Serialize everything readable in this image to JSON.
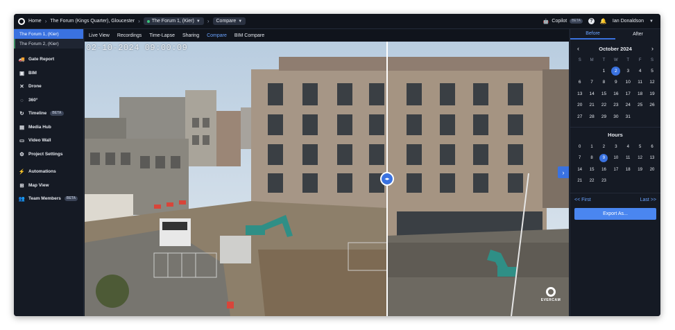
{
  "breadcrumb": {
    "home": "Home",
    "project": "The Forum (Kings Quarter), Gloucester",
    "camera": "The Forum 1, (Kier)",
    "page": "Compare"
  },
  "header": {
    "copilot": "Copilot",
    "copilot_badge": "BETA",
    "help_icon": "?",
    "user": "Ian Donaldson"
  },
  "sidebar": {
    "cameras": [
      "The Forum 1, (Kier)",
      "The Forum 2, (Kier)"
    ],
    "items": [
      {
        "label": "Gate Report",
        "icon": "truck-icon"
      },
      {
        "label": "BIM",
        "icon": "bim-icon"
      },
      {
        "label": "Drone",
        "icon": "drone-icon"
      },
      {
        "label": "360°",
        "icon": "360-icon"
      },
      {
        "label": "Timeline",
        "icon": "timeline-icon",
        "badge": "BETA"
      },
      {
        "label": "Media Hub",
        "icon": "media-icon"
      },
      {
        "label": "Video Wall",
        "icon": "video-wall-icon"
      },
      {
        "label": "Project Settings",
        "icon": "gear-icon"
      },
      {
        "label": "Automations",
        "icon": "automations-icon"
      },
      {
        "label": "Map View",
        "icon": "map-icon"
      },
      {
        "label": "Team Members",
        "icon": "team-icon",
        "badge": "BETA"
      }
    ]
  },
  "tabs": [
    "Live View",
    "Recordings",
    "Time-Lapse",
    "Sharing",
    "Compare",
    "BIM Compare"
  ],
  "active_tab": "Compare",
  "viewer": {
    "timestamp": "02-10-2024 09:00:09",
    "watermark": "EVERCAM"
  },
  "panel": {
    "before_label": "Before",
    "after_label": "After",
    "month": "October 2024",
    "weekdays": [
      "S",
      "M",
      "T",
      "W",
      "T",
      "F",
      "S"
    ],
    "days": [
      {
        "d": "",
        "m": false
      },
      {
        "d": "",
        "m": false
      },
      {
        "d": "1",
        "m": false
      },
      {
        "d": "2",
        "m": false,
        "sel": true
      },
      {
        "d": "3",
        "m": false
      },
      {
        "d": "4",
        "m": false
      },
      {
        "d": "5",
        "m": false
      },
      {
        "d": "6",
        "m": false
      },
      {
        "d": "7",
        "m": false
      },
      {
        "d": "8",
        "m": false
      },
      {
        "d": "9",
        "m": false
      },
      {
        "d": "10",
        "m": false
      },
      {
        "d": "11",
        "m": false
      },
      {
        "d": "12",
        "m": false
      },
      {
        "d": "13",
        "m": false
      },
      {
        "d": "14",
        "m": false
      },
      {
        "d": "15",
        "m": false
      },
      {
        "d": "16",
        "m": false
      },
      {
        "d": "17",
        "m": false
      },
      {
        "d": "18",
        "m": false
      },
      {
        "d": "19",
        "m": false
      },
      {
        "d": "20",
        "m": false
      },
      {
        "d": "21",
        "m": false
      },
      {
        "d": "22",
        "m": false
      },
      {
        "d": "23",
        "m": false
      },
      {
        "d": "24",
        "m": false
      },
      {
        "d": "25",
        "m": false
      },
      {
        "d": "26",
        "m": false
      },
      {
        "d": "27",
        "m": false
      },
      {
        "d": "28",
        "m": false
      },
      {
        "d": "29",
        "m": false
      },
      {
        "d": "30",
        "m": false
      },
      {
        "d": "31",
        "m": false
      },
      {
        "d": "",
        "m": false
      },
      {
        "d": "",
        "m": false
      }
    ],
    "hours_title": "Hours",
    "hours": [
      "0",
      "1",
      "2",
      "3",
      "4",
      "5",
      "6",
      "7",
      "8",
      "9",
      "10",
      "11",
      "12",
      "13",
      "14",
      "15",
      "16",
      "17",
      "18",
      "19",
      "20",
      "21",
      "22",
      "23"
    ],
    "selected_hour": "9",
    "first_label": "<< First",
    "last_label": "Last >>",
    "export_label": "Export As..."
  },
  "colors": {
    "accent": "#3a72e0",
    "link": "#6aa3ff",
    "background": "#151a24"
  }
}
